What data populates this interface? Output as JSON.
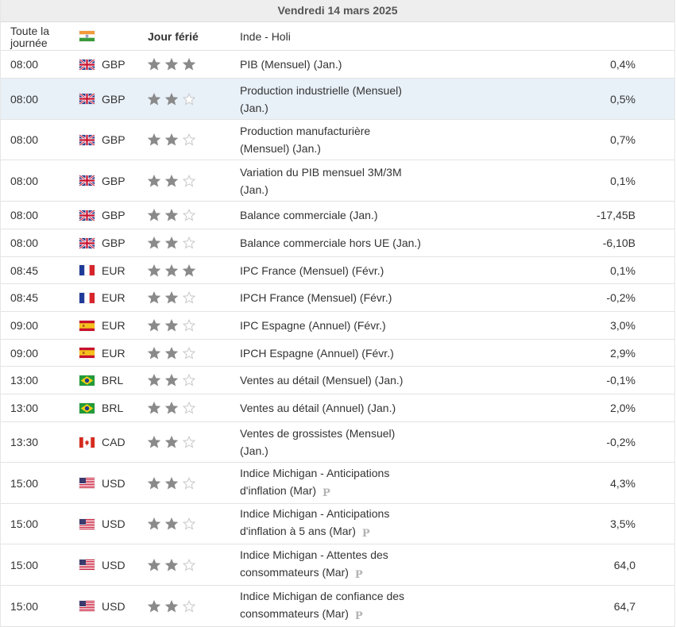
{
  "day_header": "Vendredi 14 mars 2025",
  "holiday": {
    "time": "Toute la journée",
    "flag": "india-flag",
    "label": "Jour férié",
    "event": "Inde - Holi"
  },
  "events": [
    {
      "time": "08:00",
      "flag": "uk",
      "currency": "GBP",
      "stars": 3,
      "event": "PIB (Mensuel) (Jan.)",
      "value": "0,4%",
      "prelim": false,
      "highlight": false,
      "h": 34
    },
    {
      "time": "08:00",
      "flag": "uk",
      "currency": "GBP",
      "stars": 2,
      "event": "Production industrielle (Mensuel) (Jan.)",
      "value": "0,5%",
      "prelim": false,
      "highlight": true,
      "h": 51
    },
    {
      "time": "08:00",
      "flag": "uk",
      "currency": "GBP",
      "stars": 2,
      "event": "Production manufacturière (Mensuel) (Jan.)",
      "value": "0,7%",
      "prelim": false,
      "highlight": false,
      "h": 50
    },
    {
      "time": "08:00",
      "flag": "uk",
      "currency": "GBP",
      "stars": 2,
      "event": "Variation du PIB mensuel 3M/3M (Jan.)",
      "value": "0,1%",
      "prelim": false,
      "highlight": false,
      "h": 51
    },
    {
      "time": "08:00",
      "flag": "uk",
      "currency": "GBP",
      "stars": 2,
      "event": "Balance commerciale (Jan.)",
      "value": "-17,45B",
      "prelim": false,
      "highlight": false,
      "h": 34
    },
    {
      "time": "08:00",
      "flag": "uk",
      "currency": "GBP",
      "stars": 2,
      "event": "Balance commerciale hors UE (Jan.)",
      "value": "-6,10B",
      "prelim": false,
      "highlight": false,
      "h": 34
    },
    {
      "time": "08:45",
      "flag": "fr",
      "currency": "EUR",
      "stars": 3,
      "event": "IPC France (Mensuel) (Févr.)",
      "value": "0,1%",
      "prelim": false,
      "highlight": false,
      "h": 33
    },
    {
      "time": "08:45",
      "flag": "fr",
      "currency": "EUR",
      "stars": 2,
      "event": "IPCH France (Mensuel) (Févr.)",
      "value": "-0,2%",
      "prelim": false,
      "highlight": false,
      "h": 34
    },
    {
      "time": "09:00",
      "flag": "es",
      "currency": "EUR",
      "stars": 2,
      "event": "IPC Espagne (Annuel) (Févr.)",
      "value": "3,0%",
      "prelim": false,
      "highlight": false,
      "h": 34
    },
    {
      "time": "09:00",
      "flag": "es",
      "currency": "EUR",
      "stars": 2,
      "event": "IPCH Espagne (Annuel) (Févr.)",
      "value": "2,9%",
      "prelim": false,
      "highlight": false,
      "h": 33
    },
    {
      "time": "13:00",
      "flag": "br",
      "currency": "BRL",
      "stars": 2,
      "event": "Ventes au détail (Mensuel) (Jan.)",
      "value": "-0,1%",
      "prelim": false,
      "highlight": false,
      "h": 34
    },
    {
      "time": "13:00",
      "flag": "br",
      "currency": "BRL",
      "stars": 2,
      "event": "Ventes au détail (Annuel) (Jan.)",
      "value": "2,0%",
      "prelim": false,
      "highlight": false,
      "h": 34
    },
    {
      "time": "13:30",
      "flag": "ca",
      "currency": "CAD",
      "stars": 2,
      "event": "Ventes de grossistes (Mensuel) (Jan.)",
      "value": "-0,2%",
      "prelim": false,
      "highlight": false,
      "h": 50
    },
    {
      "time": "15:00",
      "flag": "us",
      "currency": "USD",
      "stars": 2,
      "event": "Indice Michigan - Anticipations d'inflation (Mar)",
      "value": "4,3%",
      "prelim": true,
      "highlight": false,
      "h": 51
    },
    {
      "time": "15:00",
      "flag": "us",
      "currency": "USD",
      "stars": 2,
      "event": "Indice Michigan - Anticipations d'inflation à 5 ans (Mar)",
      "value": "3,5%",
      "prelim": true,
      "highlight": false,
      "h": 50
    },
    {
      "time": "15:00",
      "flag": "us",
      "currency": "USD",
      "stars": 2,
      "event": "Indice Michigan - Attentes des consommateurs (Mar)",
      "value": "64,0",
      "prelim": true,
      "highlight": false,
      "h": 51
    },
    {
      "time": "15:00",
      "flag": "us",
      "currency": "USD",
      "stars": 2,
      "event": "Indice Michigan de confiance des consommateurs (Mar)",
      "value": "64,7",
      "prelim": true,
      "highlight": false,
      "h": 51
    }
  ],
  "prelim_mark": "P",
  "colors": {
    "star_on": "#8a8a8a",
    "star_off": "#c8c8c8",
    "highlight": "#e8f0f8"
  }
}
